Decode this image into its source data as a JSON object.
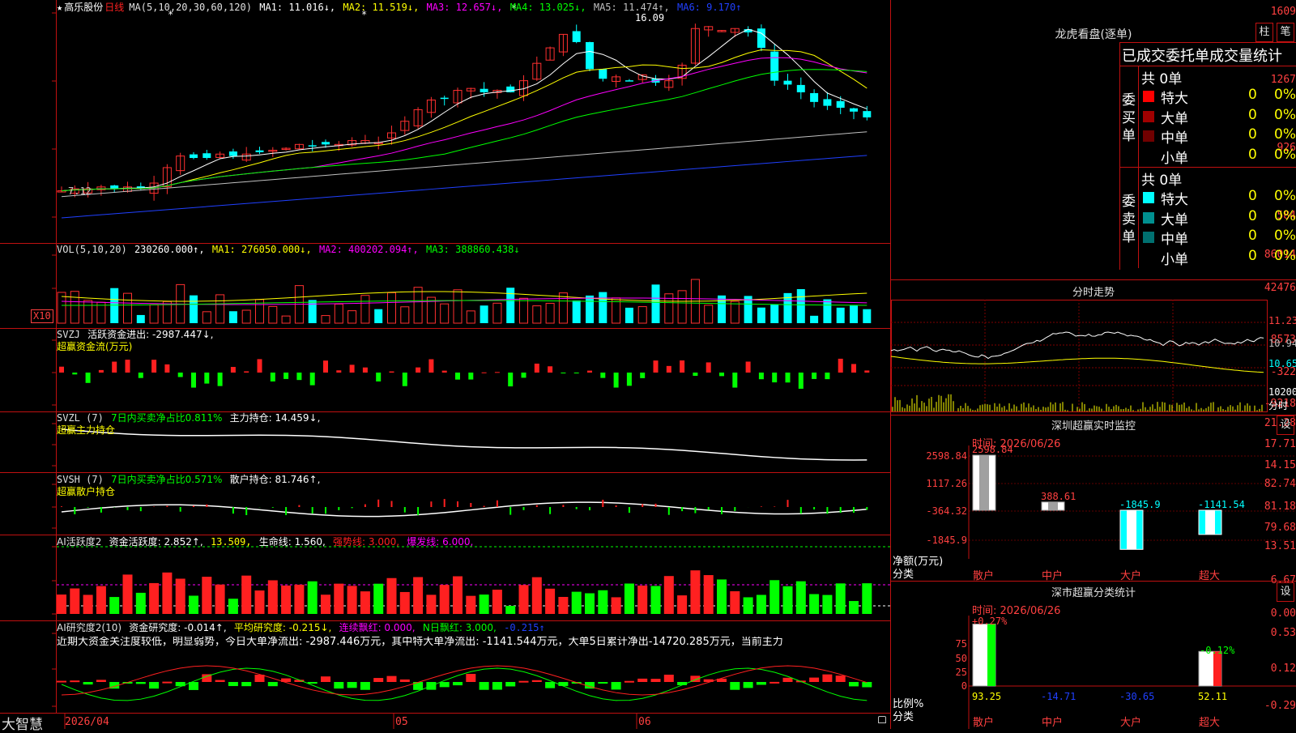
{
  "stock": {
    "star": "★",
    "name": "高乐股份",
    "period": "日线"
  },
  "price_panel": {
    "ma_label": "MA(5,10,20,30,60,120)",
    "ma1": "MA1: 11.016↓,",
    "ma2": "MA2: 11.519↓,",
    "ma3": "MA3: 12.657↓,",
    "ma4": "MA4: 13.025↓,",
    "ma5": "MA5: 11.474↑,",
    "ma6": "MA6: 9.170↑",
    "yticks": [
      "1609",
      "1267",
      "926",
      "584"
    ],
    "high_label": "16.09",
    "low_label": "7.12"
  },
  "vol_panel": {
    "label": "VOL(5,10,20)",
    "value": "230260.000↑,",
    "ma1": "MA1: 276050.000↓,",
    "ma2": "MA2: 400202.094↑,",
    "ma3": "MA3: 388860.438↓",
    "yticks": [
      "86014",
      "42476"
    ],
    "unit": "X10"
  },
  "svzj_panel": {
    "label": "SVZJ",
    "desc": "活跃资金进出: -2987.447↓,",
    "sub": "超赢资金流(万元)",
    "yticks": [
      "8573",
      "-322",
      "-9218"
    ]
  },
  "svzl_panel": {
    "label": "SVZL (7)",
    "desc": "7日内买卖净占比0.811%",
    "hold": "主力持仓: 14.459↓,",
    "sub": "超赢主力持仓",
    "yticks": [
      "21.28",
      "17.71",
      "14.15"
    ]
  },
  "svsh_panel": {
    "label": "SVSH (7)",
    "desc": "7日内买卖净占比0.571%",
    "hold": "散户持仓: 81.746↑,",
    "sub": "超赢散户持仓",
    "yticks": [
      "82.74",
      "81.18",
      "79.68"
    ]
  },
  "ai_active_panel": {
    "label": "AI活跃度2",
    "desc": "资金活跃度: 2.852↑,",
    "v2": "13.509,",
    "life": "生命线: 1.560,",
    "strong": "强势线: 3.000,",
    "burst": "爆发线: 6.000,",
    "yticks": [
      "13.51",
      "6.67",
      "0.00"
    ]
  },
  "ai_research_panel": {
    "label": "AI研究度2(10)",
    "desc": "资金研究度: -0.014↑,",
    "avg": "平均研究度: -0.215↓,",
    "red": "连续飘红: 0.000,",
    "nred": "N日飘红: 3.000,",
    "last": "-0.215↑",
    "comment": "近期大资金关注度较低，明显弱势，今日大单净流出: -2987.446万元，其中特大单净流出: -1141.544万元，大单5日累计净出-14720.285万元，当前主力",
    "yticks": [
      "0.53",
      "0.12",
      "-0.29"
    ]
  },
  "xaxis": {
    "labels": [
      "2026/04",
      "05",
      "06"
    ]
  },
  "brand": "大智慧",
  "right": {
    "lhb_title": "龙虎看盘(逐单)",
    "btn1": "柱",
    "btn2": "笔",
    "stat_title": "已成交委托单成交量统计",
    "buy_side": "委买单",
    "sell_side": "委卖单",
    "buy_total": "共 0单",
    "sell_total": "共 0单",
    "buy_rows": [
      {
        "name": "特大",
        "qty": "0",
        "pct": "0%",
        "color": "#ff0000"
      },
      {
        "name": "大单",
        "qty": "0",
        "pct": "0%",
        "color": "#a00000"
      },
      {
        "name": "中单",
        "qty": "0",
        "pct": "0%",
        "color": "#700000"
      },
      {
        "name": "小单",
        "qty": "0",
        "pct": "0%",
        "color": ""
      }
    ],
    "sell_rows": [
      {
        "name": "特大",
        "qty": "0",
        "pct": "0%",
        "color": "#00ffff"
      },
      {
        "name": "大单",
        "qty": "0",
        "pct": "0%",
        "color": "#009090"
      },
      {
        "name": "中单",
        "qty": "0",
        "pct": "0%",
        "color": "#007070"
      },
      {
        "name": "小单",
        "qty": "0",
        "pct": "0%",
        "color": ""
      }
    ],
    "intraday_title": "分时走势",
    "intraday_yticks": [
      "11.23",
      "10.94",
      "10.65",
      "10200",
      "分时"
    ],
    "monitor_title": "深圳超赢实时监控",
    "monitor_btn": "设",
    "monitor_time": "时间: 2026/06/26",
    "monitor_yticks": [
      "2598.84",
      "1117.26",
      "-364.32",
      "-1845.9"
    ],
    "monitor_values": [
      "2598.84",
      "388.61",
      "-1845.9",
      "-1141.54"
    ],
    "monitor_unit": "净额(万元)",
    "monitor_cat": "分类",
    "monitor_cats": [
      "散户",
      "中户",
      "大户",
      "超大"
    ],
    "stat2_title": "深市超赢分类统计",
    "stat2_btn": "设",
    "stat2_time": "时间: 2026/06/26",
    "stat2_top": [
      "+0.27%",
      "-0.12%"
    ],
    "stat2_yticks": [
      "75",
      "50",
      "25",
      "0"
    ],
    "stat2_values": [
      "93.25",
      "-14.71",
      "-30.65",
      "52.11"
    ],
    "stat2_unit": "比例%",
    "stat2_cat": "分类",
    "stat2_cats": [
      "散户",
      "中户",
      "大户",
      "超大"
    ]
  }
}
